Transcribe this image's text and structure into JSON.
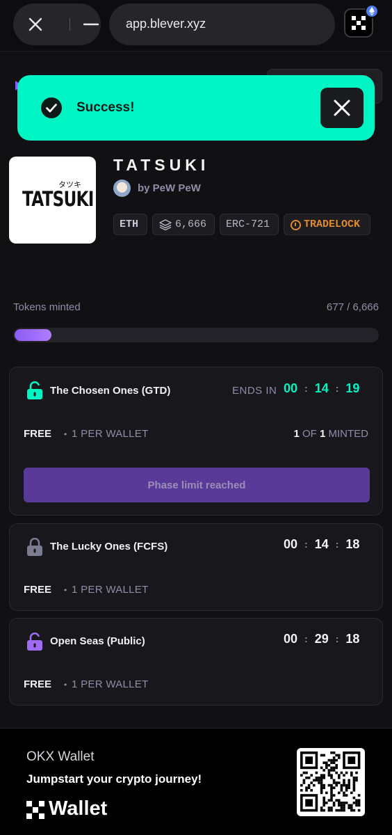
{
  "browser": {
    "url": "app.blever.xyz",
    "icons": [
      "close-icon",
      "minimize-icon",
      "okx-icon",
      "ethereum-icon"
    ]
  },
  "toast": {
    "message": "Success!",
    "bg_color": "#00f5c4"
  },
  "collection": {
    "name": "TATSUKI",
    "logo_word": "TATSUKI",
    "logo_kana": "タツキ",
    "creator": "by PeW PeW",
    "tags": {
      "chain": "ETH",
      "supply": "6,666",
      "standard": "ERC-721",
      "lock": "TRADELOCK"
    }
  },
  "mint_progress": {
    "label": "Tokens minted",
    "count_text": "677 / 6,666",
    "minted": 677,
    "total": 6666
  },
  "phases": [
    {
      "name": "The Chosen Ones (GTD)",
      "status": "unlocked",
      "ends_label": "ENDS IN",
      "timer": {
        "h": "00",
        "m": "14",
        "s": "19"
      },
      "price": "FREE",
      "limit": "1 PER WALLET",
      "minted_count": "1",
      "minted_of": "OF",
      "minted_total": "1",
      "minted_suffix": "MINTED",
      "button": "Phase limit reached"
    },
    {
      "name": "The Lucky Ones (FCFS)",
      "status": "locked",
      "timer": {
        "h": "00",
        "m": "14",
        "s": "18"
      },
      "price": "FREE",
      "limit": "1 PER WALLET"
    },
    {
      "name": "Open Seas (Public)",
      "status": "upcoming",
      "timer": {
        "h": "00",
        "m": "29",
        "s": "18"
      },
      "price": "FREE",
      "limit": "1 PER WALLET"
    }
  ],
  "footer": {
    "brand": "OKX Wallet",
    "tagline": "Jumpstart your crypto journey!",
    "logo_text": "Wallet"
  },
  "colors": {
    "accent_teal": "#00f5c4",
    "accent_purple": "#8b5cf6",
    "warning_orange": "#e08a2e"
  }
}
